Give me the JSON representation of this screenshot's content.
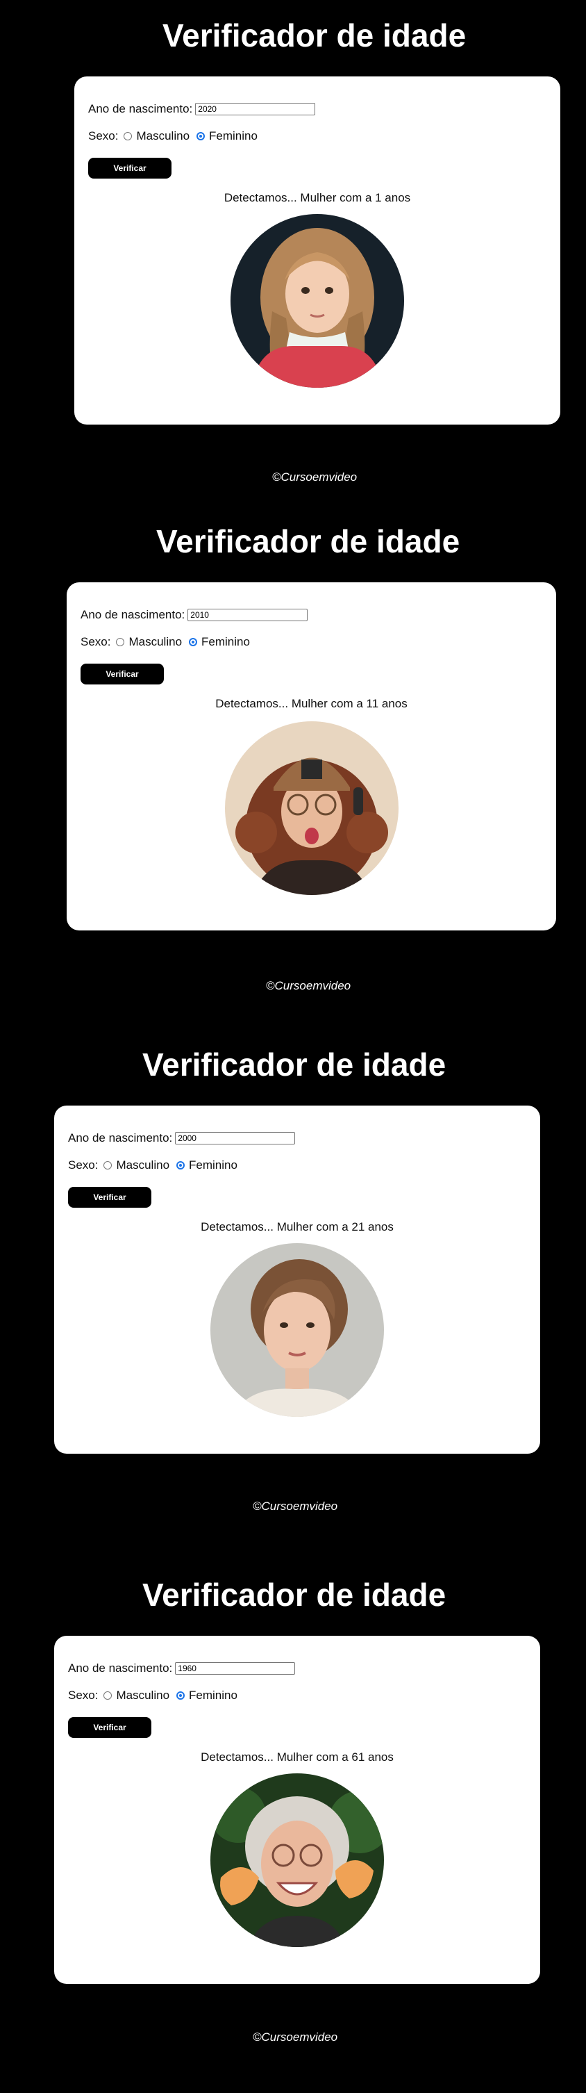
{
  "sections": [
    {
      "title": "Verificador de idade",
      "year_label": "Ano de nascimento:",
      "year_value": "2020",
      "sex_label": "Sexo:",
      "option_male": "Masculino",
      "option_female": "Feminino",
      "selected_sex": "Feminino",
      "button_label": "Verificar",
      "result": "Detectamos... Mulher com a 1 anos",
      "photo_icon": "child-girl-photo",
      "footer": "©Cursoemvideo"
    },
    {
      "title": "Verificador de idade",
      "year_label": "Ano de nascimento:",
      "year_value": "2010",
      "sex_label": "Sexo:",
      "option_male": "Masculino",
      "option_female": "Feminino",
      "selected_sex": "Feminino",
      "button_label": "Verificar",
      "result": "Detectamos... Mulher com a 11 anos",
      "photo_icon": "teen-girl-photo",
      "footer": "©Cursoemvideo"
    },
    {
      "title": "Verificador de idade",
      "year_label": "Ano de nascimento:",
      "year_value": "2000",
      "sex_label": "Sexo:",
      "option_male": "Masculino",
      "option_female": "Feminino",
      "selected_sex": "Feminino",
      "button_label": "Verificar",
      "result": "Detectamos... Mulher com a 21 anos",
      "photo_icon": "young-woman-photo",
      "footer": "©Cursoemvideo"
    },
    {
      "title": "Verificador de idade",
      "year_label": "Ano de nascimento:",
      "year_value": "1960",
      "sex_label": "Sexo:",
      "option_male": "Masculino",
      "option_female": "Feminino",
      "selected_sex": "Feminino",
      "button_label": "Verificar",
      "result": "Detectamos... Mulher com a 61 anos",
      "photo_icon": "elderly-woman-photo",
      "footer": "©Cursoemvideo"
    }
  ],
  "colors": {
    "background": "#000000",
    "card": "#ffffff",
    "button": "#000000",
    "radio_checked": "#1a73e8"
  }
}
